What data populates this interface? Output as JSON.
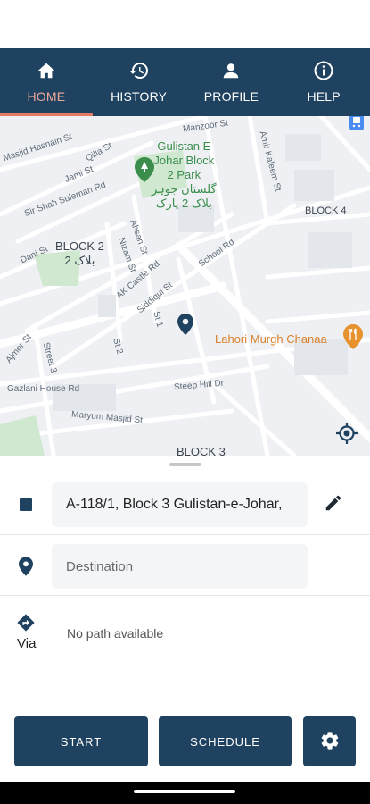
{
  "nav": {
    "tabs": [
      {
        "label": "HOME",
        "icon": "home-icon",
        "active": true
      },
      {
        "label": "HISTORY",
        "icon": "history-icon",
        "active": false
      },
      {
        "label": "PROFILE",
        "icon": "person-icon",
        "active": false
      },
      {
        "label": "HELP",
        "icon": "info-icon",
        "active": false
      }
    ],
    "accent": "#e27a64",
    "bar_color": "#1f4260"
  },
  "map": {
    "labels": {
      "manzoor": "Manzoor St",
      "masjid": "Masjid Hasnain St",
      "qilla": "Qilla St",
      "jami": "Jami St",
      "park_name": "Gulistan E\nJohar Block\n2 Park\nگلستان جوہر\nبلاک 2 پارک",
      "sir_shah": "Sir Shah Suleman Rd",
      "amir": "Amir Kaleem St",
      "block4": "BLOCK 4",
      "block2": "BLOCK 2\nبلاک 2",
      "dani": "Dani St",
      "ahsan": "Ahsan St",
      "nizam": "Nizam St",
      "school": "School Rd",
      "ak_castle": "AK Castle Rd",
      "siddiqui": "Siddiqui St",
      "st1": "St 1",
      "st2": "St 2",
      "street3": "Street 3",
      "ajmer": "Ajmer St",
      "gazlani": "Gazlani House Rd",
      "steep": "Steep Hill Dr",
      "maryum": "Maryum Masjid St",
      "block3": "BLOCK 3",
      "lahori": "Lahori Murgh Chanaa"
    }
  },
  "route": {
    "origin_value": "A-118/1, Block 3 Gulistan-e-Johar,",
    "destination_placeholder": "Destination",
    "via_label": "Via",
    "via_text": "No path available"
  },
  "actions": {
    "start_label": "START",
    "schedule_label": "SCHEDULE",
    "settings_icon": "gear-icon"
  }
}
